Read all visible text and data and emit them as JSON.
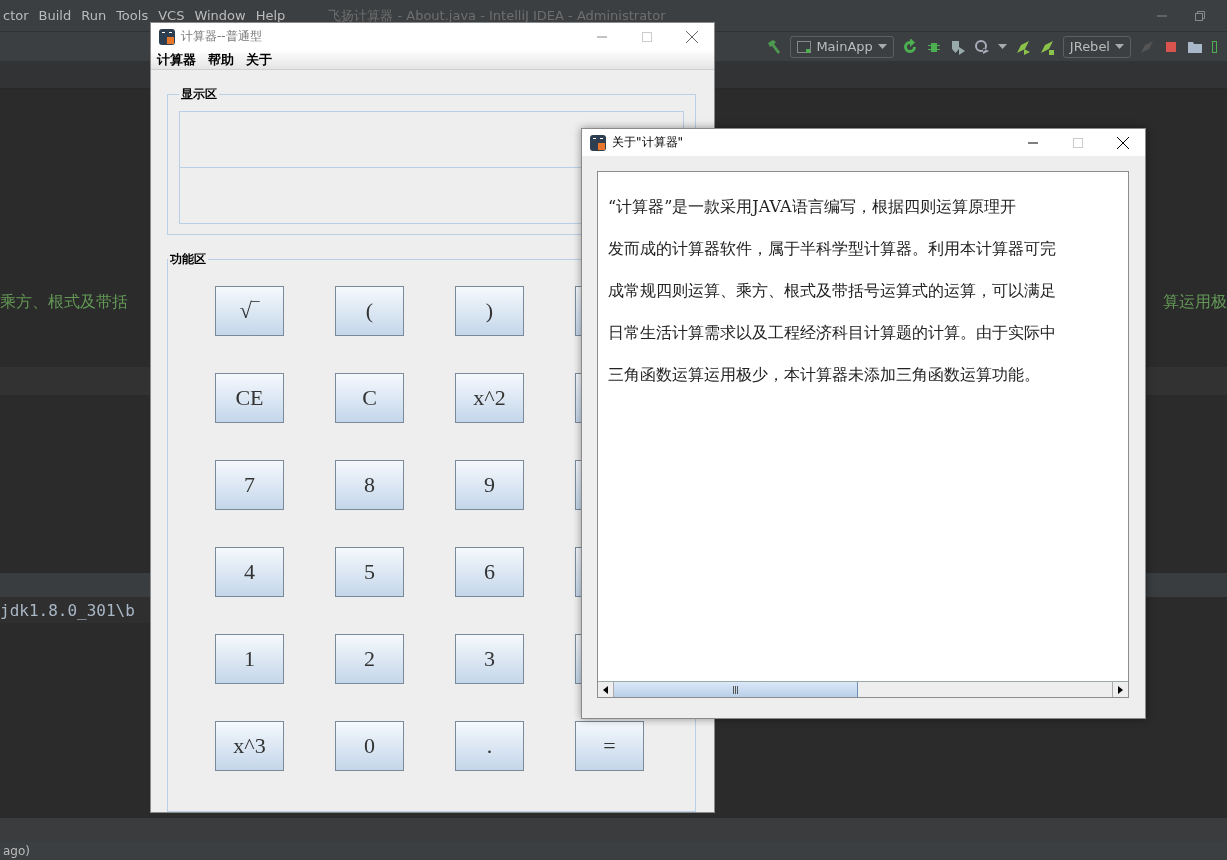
{
  "ide": {
    "menu": [
      "ctor",
      "Build",
      "Run",
      "Tools",
      "VCS",
      "Window",
      "Help"
    ],
    "title": "飞扬计算器 - About.java - IntelliJ IDEA - Administrator",
    "toolbar": {
      "run_config": "MainApp",
      "plugin": "JRebel"
    },
    "editor": {
      "line_left": "乘方、根式及带括",
      "line_right": "算运用极",
      "console_line": "jdk1.8.0_301\\b"
    },
    "status_bar": "ago)"
  },
  "calculator": {
    "title": "计算器--普通型",
    "menu": [
      "计算器",
      "帮助",
      "关于"
    ],
    "display_group": "显示区",
    "keys_group": "功能区",
    "rows": [
      [
        "√‾",
        "(",
        ")"
      ],
      [
        "CE",
        "C",
        "x^2"
      ],
      [
        "7",
        "8",
        "9"
      ],
      [
        "4",
        "5",
        "6"
      ],
      [
        "1",
        "2",
        "3"
      ],
      [
        "x^3",
        "0",
        ".",
        "="
      ]
    ]
  },
  "about": {
    "title": "关于\"计算器\"",
    "lines": [
      "“计算器”是一款采用JAVA语言编写，根据四则运算原理开",
      "发而成的计算器软件，属于半科学型计算器。利用本计算器可完",
      "成常规四则运算、乘方、根式及带括号运算式的运算，可以满足",
      "日常生活计算需求以及工程经济科目计算题的计算。由于实际中",
      "三角函数运算运用极少，本计算器未添加三角函数运算功能。"
    ],
    "scroll": {
      "level": 0.49
    }
  }
}
